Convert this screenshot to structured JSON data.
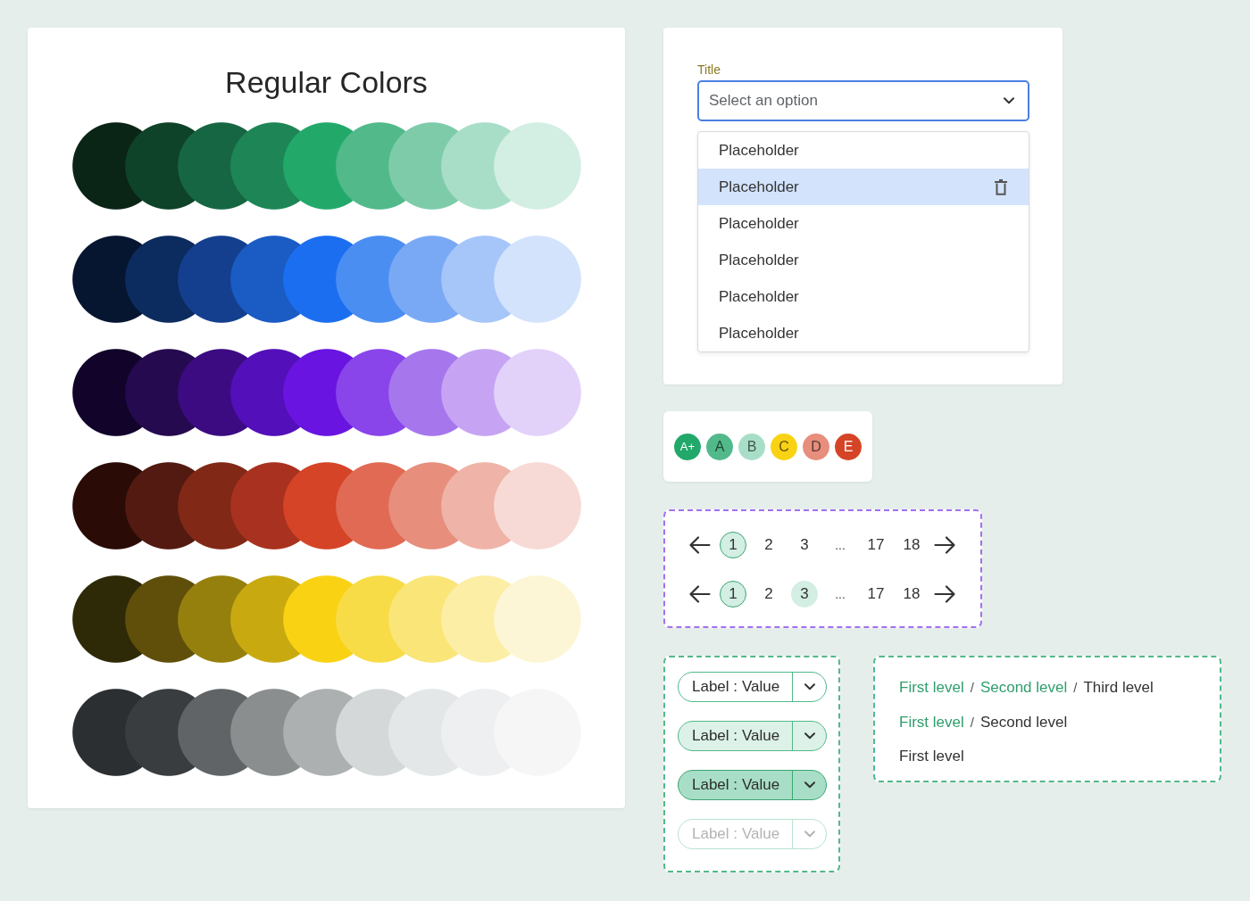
{
  "palette": {
    "title": "Regular Colors",
    "rows": [
      {
        "swatches": [
          {
            "color": "#0a2416"
          },
          {
            "color": "#0e4229"
          },
          {
            "color": "#176643"
          },
          {
            "color": "#1e8656"
          },
          {
            "color": "#22a96a"
          },
          {
            "color": "#52b98a"
          },
          {
            "color": "#7ecbaa"
          },
          {
            "color": "#a8dec7"
          },
          {
            "color": "#d3eee2"
          }
        ]
      },
      {
        "swatches": [
          {
            "color": "#061630"
          },
          {
            "color": "#0c2b5e"
          },
          {
            "color": "#133f8e"
          },
          {
            "color": "#1a5bc4"
          },
          {
            "color": "#1b6ef0"
          },
          {
            "color": "#4a8ef2"
          },
          {
            "color": "#79a9f5"
          },
          {
            "color": "#a6c6f9"
          },
          {
            "color": "#d3e3fc"
          }
        ]
      },
      {
        "swatches": [
          {
            "color": "#12032a"
          },
          {
            "color": "#250a4f"
          },
          {
            "color": "#3c0b82"
          },
          {
            "color": "#530fba"
          },
          {
            "color": "#6914e0"
          },
          {
            "color": "#8944ea"
          },
          {
            "color": "#a676ed"
          },
          {
            "color": "#c6a4f3"
          },
          {
            "color": "#e2d2fa"
          }
        ]
      },
      {
        "swatches": [
          {
            "color": "#2a0b06"
          },
          {
            "color": "#521a10"
          },
          {
            "color": "#812816"
          },
          {
            "color": "#a8321f"
          },
          {
            "color": "#d54426"
          },
          {
            "color": "#e06a53"
          },
          {
            "color": "#e78e7d"
          },
          {
            "color": "#efb3a7"
          },
          {
            "color": "#f7dad5"
          }
        ]
      },
      {
        "swatches": [
          {
            "color": "#2e2906"
          },
          {
            "color": "#5f4f0a"
          },
          {
            "color": "#95800e"
          },
          {
            "color": "#c8aa10"
          },
          {
            "color": "#f9d214"
          },
          {
            "color": "#f8dc47"
          },
          {
            "color": "#fae579"
          },
          {
            "color": "#fdeea6"
          },
          {
            "color": "#fdf6d6"
          }
        ]
      },
      {
        "swatches": [
          {
            "color": "#2c2f31"
          },
          {
            "color": "#3a3d40"
          },
          {
            "color": "#606466"
          },
          {
            "color": "#8a8e8f"
          },
          {
            "color": "#adb0b1"
          },
          {
            "color": "#d4d8d9"
          },
          {
            "color": "#e3e7e8"
          },
          {
            "color": "#eeeff0"
          },
          {
            "color": "#f6f6f6"
          }
        ]
      }
    ]
  },
  "select": {
    "label": "Title",
    "placeholder": "Select an option",
    "expanded": true,
    "options": [
      {
        "text": "Placeholder",
        "selected": false
      },
      {
        "text": "Placeholder",
        "selected": true
      },
      {
        "text": "Placeholder",
        "selected": false
      },
      {
        "text": "Placeholder",
        "selected": false
      },
      {
        "text": "Placeholder",
        "selected": false
      },
      {
        "text": "Placeholder",
        "selected": false
      }
    ]
  },
  "grades": [
    {
      "text": "A+",
      "color": "#22a86a"
    },
    {
      "text": "A",
      "color": "#52b98a"
    },
    {
      "text": "B",
      "color": "#a8dec7"
    },
    {
      "text": "C",
      "color": "#f9d214"
    },
    {
      "text": "D",
      "color": "#e78e7d"
    },
    {
      "text": "E",
      "color": "#d54426"
    }
  ],
  "pagination": {
    "rows": [
      {
        "pages": [
          {
            "kind": "page",
            "text": "1",
            "selected": true,
            "hovered": false
          },
          {
            "kind": "page",
            "text": "2",
            "selected": false,
            "hovered": false
          },
          {
            "kind": "page",
            "text": "3",
            "selected": false,
            "hovered": false
          },
          {
            "kind": "ellipsis",
            "text": "..."
          },
          {
            "kind": "page",
            "text": "17",
            "selected": false,
            "hovered": false
          },
          {
            "kind": "page",
            "text": "18",
            "selected": false,
            "hovered": false
          }
        ]
      },
      {
        "pages": [
          {
            "kind": "page",
            "text": "1",
            "selected": true,
            "hovered": false
          },
          {
            "kind": "page",
            "text": "2",
            "selected": false,
            "hovered": false
          },
          {
            "kind": "page",
            "text": "3",
            "selected": false,
            "hovered": true
          },
          {
            "kind": "ellipsis",
            "text": "..."
          },
          {
            "kind": "page",
            "text": "17",
            "selected": false,
            "hovered": false
          },
          {
            "kind": "page",
            "text": "18",
            "selected": false,
            "hovered": false
          }
        ]
      }
    ]
  },
  "chips": [
    {
      "label": "Label :",
      "value": "Value",
      "hovered": false,
      "pressed": false,
      "disabled": false
    },
    {
      "label": "Label :",
      "value": "Value",
      "hovered": true,
      "pressed": false,
      "disabled": false
    },
    {
      "label": "Label :",
      "value": "Value",
      "hovered": false,
      "pressed": true,
      "disabled": false
    },
    {
      "label": "Label :",
      "value": "Value",
      "hovered": false,
      "pressed": false,
      "disabled": true
    }
  ],
  "breadcrumbs": [
    {
      "items": [
        {
          "kind": "link",
          "text": "First level"
        },
        {
          "kind": "separator",
          "text": "/"
        },
        {
          "kind": "link",
          "text": "Second level"
        },
        {
          "kind": "separator",
          "text": "/"
        },
        {
          "kind": "current",
          "text": "Third level"
        }
      ]
    },
    {
      "items": [
        {
          "kind": "link",
          "text": "First level"
        },
        {
          "kind": "separator",
          "text": "/"
        },
        {
          "kind": "current",
          "text": "Second level"
        }
      ]
    },
    {
      "items": [
        {
          "kind": "current",
          "text": "First level"
        }
      ]
    }
  ]
}
